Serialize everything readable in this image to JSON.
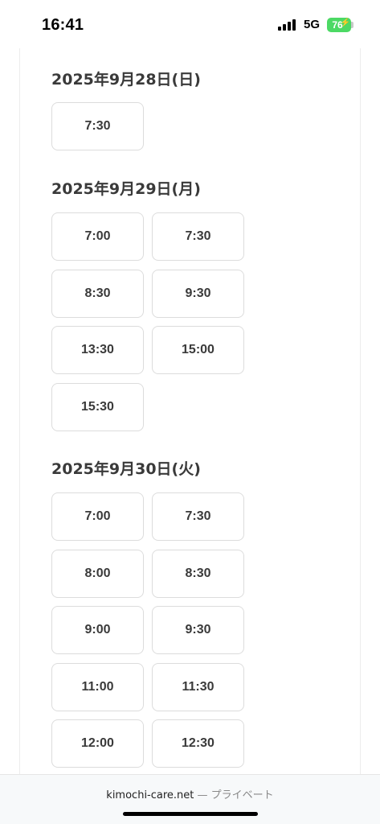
{
  "status_bar": {
    "time": "16:41",
    "network": "5G",
    "battery": "76"
  },
  "days": [
    {
      "heading": "2025年9月28日(日)",
      "slots": [
        "7:30"
      ]
    },
    {
      "heading": "2025年9月29日(月)",
      "slots": [
        "7:00",
        "7:30",
        "8:30",
        "9:30",
        "13:30",
        "15:00",
        "15:30"
      ]
    },
    {
      "heading": "2025年9月30日(火)",
      "slots": [
        "7:00",
        "7:30",
        "8:00",
        "8:30",
        "9:00",
        "9:30",
        "11:00",
        "11:30",
        "12:00",
        "12:30"
      ]
    }
  ],
  "url_bar": {
    "domain": "kimochi-care.net",
    "separator": "—",
    "mode": "プライベート"
  }
}
